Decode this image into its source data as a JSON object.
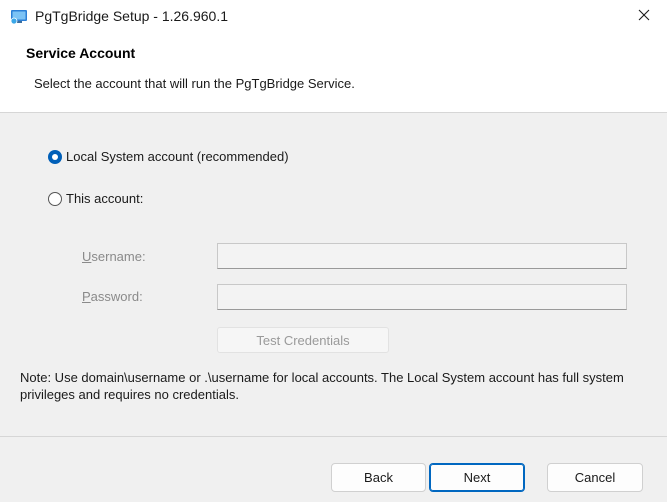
{
  "window": {
    "title": "PgTgBridge Setup - 1.26.960.1",
    "close_glyph": "✕"
  },
  "header": {
    "title": "Service Account",
    "description": "Select the account that will run the PgTgBridge Service."
  },
  "account_options": [
    {
      "label": "Local System account (recommended)",
      "checked": true
    },
    {
      "label": "This account:",
      "checked": false
    }
  ],
  "fields": {
    "username": {
      "label_underlined": "U",
      "label_rest": "sername:",
      "value": ""
    },
    "password": {
      "label_underlined": "P",
      "label_rest": "assword:",
      "value": ""
    }
  },
  "test_credentials_label": "Test Credentials",
  "note": "Note: Use domain\\username or .\\username for local accounts. The Local System account has full system privileges and requires no credentials.",
  "buttons": {
    "back": "Back",
    "next": "Next",
    "cancel": "Cancel"
  },
  "colors": {
    "accent": "#005fb8",
    "body_background": "#f0f0f0"
  }
}
